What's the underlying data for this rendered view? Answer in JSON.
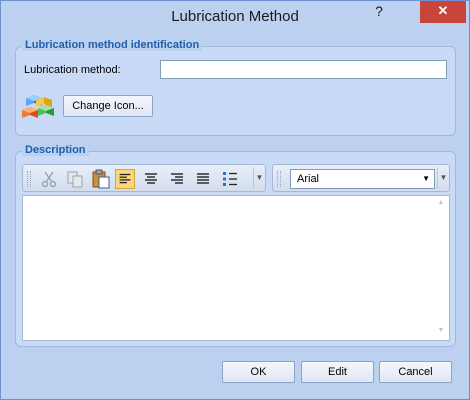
{
  "window": {
    "title": "Lubrication Method",
    "help_glyph": "?",
    "close_glyph": "✕"
  },
  "identification": {
    "group_title": "Lubrication method identification",
    "method_label": "Lubrication method:",
    "method_value": "",
    "change_icon_label": "Change Icon..."
  },
  "description": {
    "group_title": "Description",
    "toolbar": {
      "tools": [
        {
          "name": "cut-icon",
          "state": "disabled"
        },
        {
          "name": "copy-icon",
          "state": "disabled"
        },
        {
          "name": "paste-icon",
          "state": "enabled"
        },
        {
          "name": "align-left-icon",
          "state": "active"
        },
        {
          "name": "align-center-icon",
          "state": "enabled"
        },
        {
          "name": "align-right-icon",
          "state": "enabled"
        },
        {
          "name": "justify-icon",
          "state": "enabled"
        },
        {
          "name": "bullets-icon",
          "state": "enabled"
        }
      ]
    },
    "font_value": "Arial",
    "text": ""
  },
  "footer": {
    "ok_label": "OK",
    "edit_label": "Edit",
    "cancel_label": "Cancel"
  }
}
